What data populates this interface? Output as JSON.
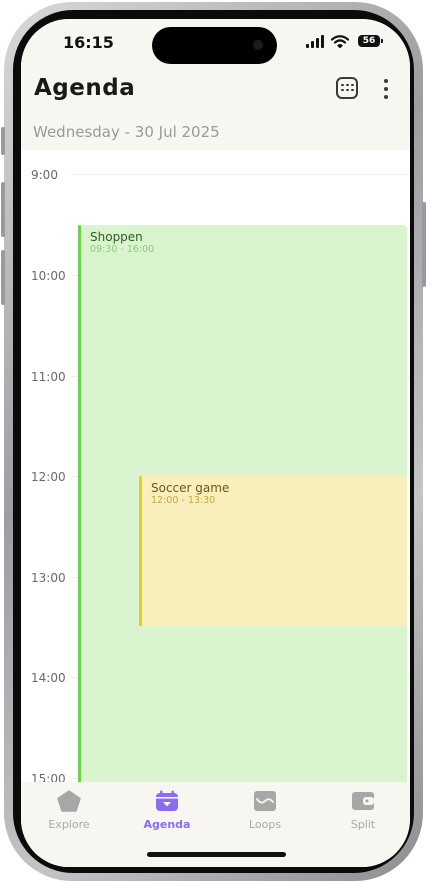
{
  "status_bar": {
    "time": "16:15",
    "battery": "56"
  },
  "header": {
    "title": "Agenda",
    "date": "Wednesday - 30 Jul 2025"
  },
  "timeline": {
    "hours": [
      "9:00",
      "10:00",
      "11:00",
      "12:00",
      "13:00",
      "14:00",
      "15:00"
    ],
    "events": [
      {
        "title": "Shoppen",
        "time": "09:30 - 16:00"
      },
      {
        "title": "Soccer game",
        "time": "12:00 - 13:30"
      }
    ]
  },
  "tabs": [
    {
      "label": "Explore",
      "icon": "pentagon-icon"
    },
    {
      "label": "Agenda",
      "icon": "calendar-icon",
      "active": true
    },
    {
      "label": "Loops",
      "icon": "loops-icon"
    },
    {
      "label": "Split",
      "icon": "wallet-icon"
    }
  ],
  "colors": {
    "accent": "#8b6cf0",
    "shoppen_bg": "#daf4cf",
    "shoppen_bar": "#6dd14e",
    "soccer_bg": "#f9efbd",
    "soccer_bar": "#f0c818"
  }
}
